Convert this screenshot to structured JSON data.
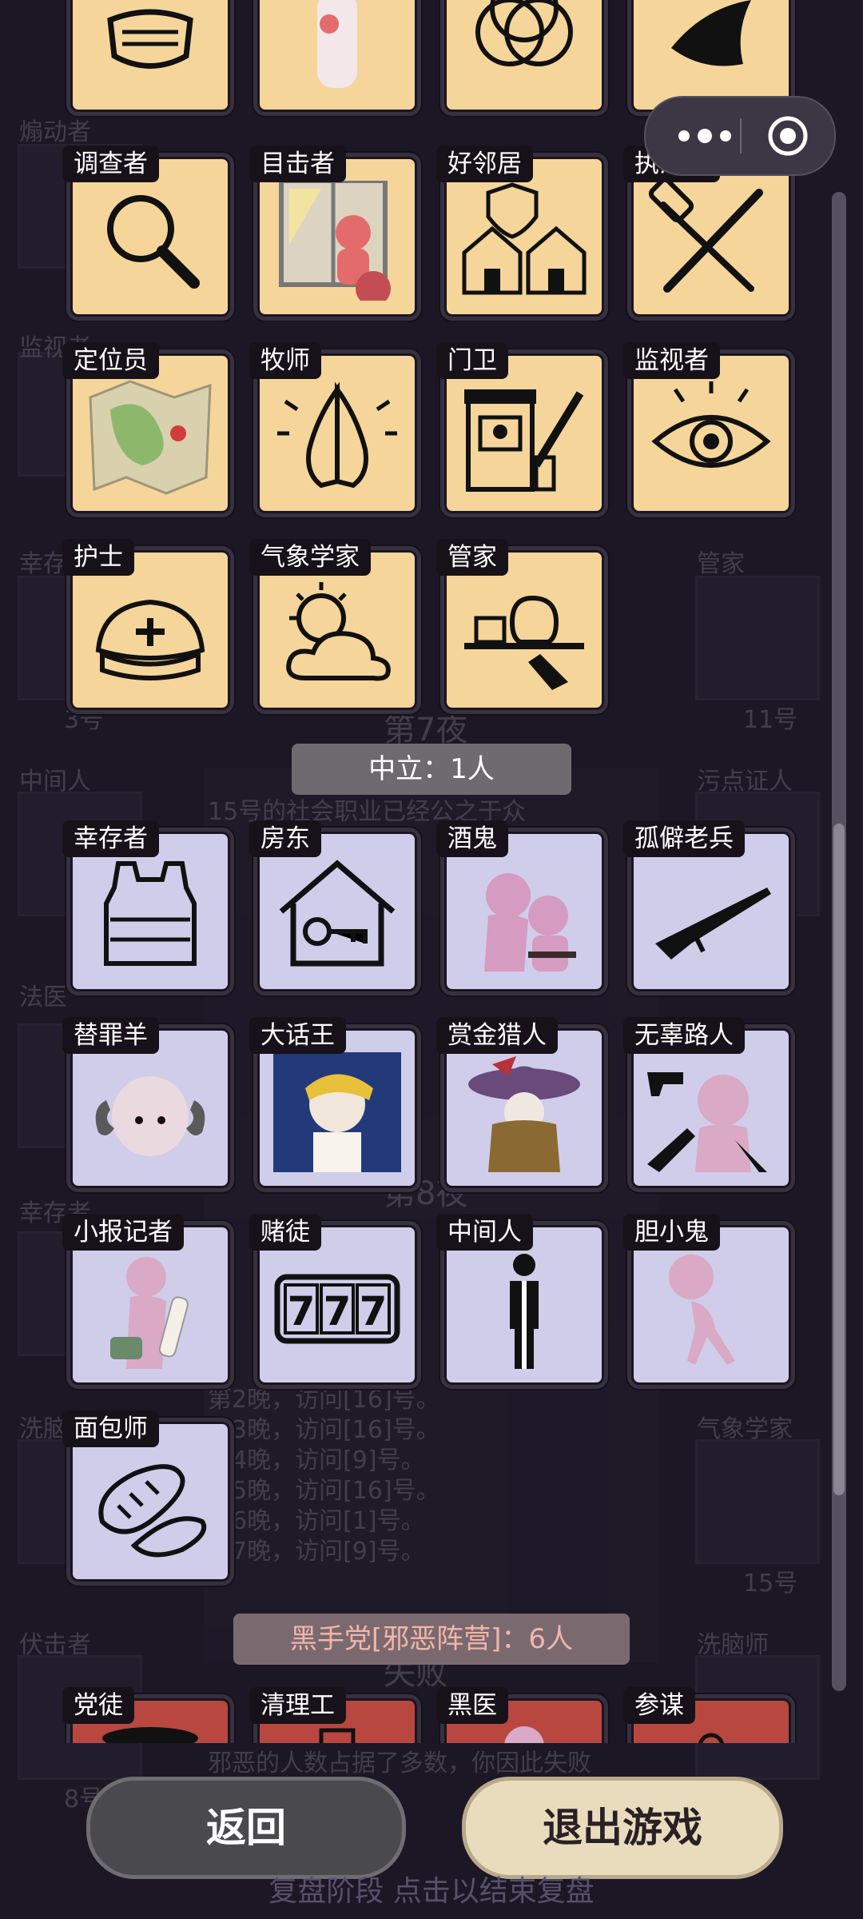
{
  "background": {
    "left_labels": [
      "煽动者",
      "监视者",
      "幸存者",
      "中间人",
      "法医",
      "幸存者",
      "洗脑师",
      "伏击者"
    ],
    "right_labels": [
      "管家",
      "污点证人",
      "气象学家",
      "洗脑师"
    ],
    "numbers": [
      "3号",
      "11号",
      "15号",
      "8号"
    ],
    "nights": [
      "第7夜",
      "第8夜",
      "失败"
    ],
    "log_lines": [
      "15号的社会职业已经公之于众",
      "第2晚，访问[16]号。",
      "第3晚，访问[16]号。",
      "第4晚，访问[9]号。",
      "第5晚，访问[16]号。",
      "第6晚，访问[1]号。",
      "第7晚，访问[9]号。",
      "邪恶的人数占据了多数，你因此失败"
    ],
    "footer_hint": "复盘阶段 点击以结束复盘"
  },
  "top_partial_icons": [
    "mask-icon",
    "witness-figure-icon",
    "venn-diagram-icon",
    "dove-icon"
  ],
  "good_roles": [
    {
      "label": "调查者",
      "icon": "magnifier-icon"
    },
    {
      "label": "目击者",
      "icon": "window-figure-icon"
    },
    {
      "label": "好邻居",
      "icon": "houses-shield-icon"
    },
    {
      "label": "执法长",
      "icon": "gavel-sword-icon"
    },
    {
      "label": "定位员",
      "icon": "map-icon"
    },
    {
      "label": "牧师",
      "icon": "praying-hands-icon"
    },
    {
      "label": "门卫",
      "icon": "gatehouse-icon"
    },
    {
      "label": "监视者",
      "icon": "eye-icon"
    },
    {
      "label": "护士",
      "icon": "nurse-cap-icon"
    },
    {
      "label": "气象学家",
      "icon": "sun-cloud-icon"
    },
    {
      "label": "管家",
      "icon": "serving-tray-icon"
    }
  ],
  "neutral_section": {
    "label": "中立：1人"
  },
  "neutral_roles": [
    {
      "label": "幸存者",
      "icon": "vest-icon"
    },
    {
      "label": "房东",
      "icon": "house-key-icon"
    },
    {
      "label": "酒鬼",
      "icon": "drunk-figures-icon"
    },
    {
      "label": "孤僻老兵",
      "icon": "rifle-icon"
    },
    {
      "label": "替罪羊",
      "icon": "ram-icon"
    },
    {
      "label": "大话王",
      "icon": "liar-portrait-icon"
    },
    {
      "label": "赏金猎人",
      "icon": "hunter-portrait-icon"
    },
    {
      "label": "无辜路人",
      "icon": "bystander-guns-icon"
    },
    {
      "label": "小报记者",
      "icon": "reporter-figure-icon"
    },
    {
      "label": "赌徒",
      "icon": "slot-777-icon"
    },
    {
      "label": "中间人",
      "icon": "half-person-icon"
    },
    {
      "label": "胆小鬼",
      "icon": "coward-figure-icon"
    },
    {
      "label": "面包师",
      "icon": "bread-icon"
    }
  ],
  "evil_section": {
    "label": "黑手党[邪恶阵营]：6人"
  },
  "evil_roles": [
    {
      "label": "党徒",
      "icon": "mafia-hat-icon"
    },
    {
      "label": "清理工",
      "icon": "cleaner-icon"
    },
    {
      "label": "黑医",
      "icon": "black-doctor-icon"
    },
    {
      "label": "参谋",
      "icon": "advisor-icon"
    }
  ],
  "buttons": {
    "back": "返回",
    "exit": "退出游戏"
  },
  "colors": {
    "good_tile": "#f5d59a",
    "neutral_tile": "#cfcdea",
    "evil_tile": "#b8473f",
    "background": "#1c1725"
  }
}
